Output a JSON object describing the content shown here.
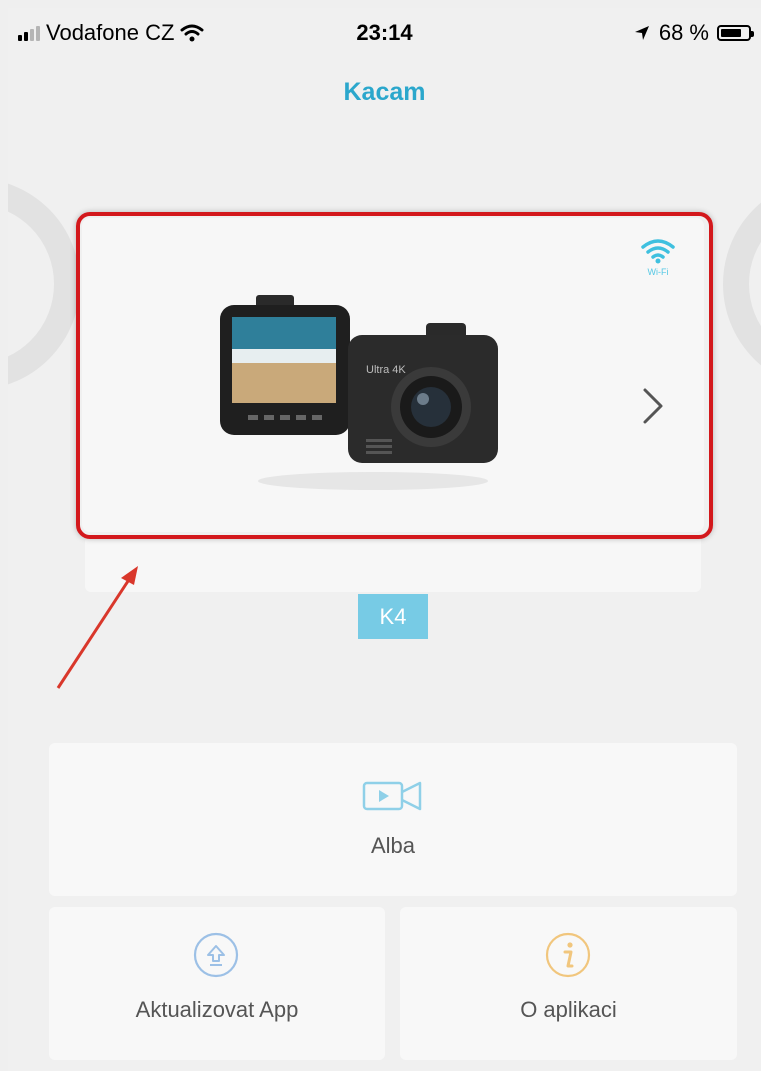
{
  "status_bar": {
    "carrier": "Vodafone CZ",
    "time": "23:14",
    "battery": "68 %",
    "battery_level": 0.68
  },
  "app": {
    "title": "Kacam"
  },
  "device": {
    "model": "K4",
    "camera_label": "Ultra 4K",
    "wifi_label": "Wi-Fi"
  },
  "menu": {
    "albums_label": "Alba",
    "update_label": "Aktualizovat App",
    "about_label": "O aplikaci"
  },
  "colors": {
    "accent": "#2ba7cc",
    "badge": "#77cbe5",
    "highlight": "#d3181c",
    "update_icon": "#9cc0e6",
    "about_icon": "#f1c67d"
  }
}
